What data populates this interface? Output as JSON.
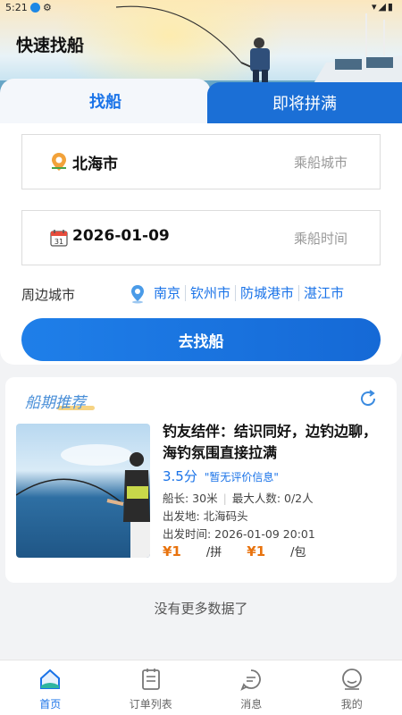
{
  "status": {
    "time": "5:21",
    "icons_right": "▾◢▮"
  },
  "header": {
    "title": "快速找船"
  },
  "tabs": [
    {
      "label": "找船",
      "active": true
    },
    {
      "label": "即将拼满",
      "active": false
    }
  ],
  "search": {
    "city": {
      "value": "北海市",
      "placeholder": "乘船城市",
      "icon": "map-pin-icon"
    },
    "date": {
      "value": "2026-01-09",
      "placeholder": "乘船时间",
      "icon": "calendar-icon"
    },
    "nearby": {
      "label": "周边城市",
      "cities": [
        "南京",
        "钦州市",
        "防城港市",
        "湛江市"
      ]
    },
    "button_label": "去找船"
  },
  "recommend": {
    "title": "船期推荐",
    "trip": {
      "name": "钓友结伴：结识同好，边钓边聊，海钓氛围直接拉满",
      "rating": "3.5分",
      "rating_note": "\"暂无评价信息\"",
      "length": "船长: 30米",
      "capacity": "最大人数: 0/2人",
      "departure": "出发地: 北海码头",
      "time": "出发时间: 2026-01-09 20:01",
      "price_share": "¥1",
      "price_share_unit": "/拼",
      "price_charter": "¥1",
      "price_charter_unit": "/包"
    }
  },
  "footer_note": "没有更多数据了",
  "nav": [
    {
      "label": "首页",
      "icon": "home-icon",
      "active": true
    },
    {
      "label": "订单列表",
      "icon": "order-list-icon",
      "active": false
    },
    {
      "label": "消息",
      "icon": "message-icon",
      "active": false
    },
    {
      "label": "我的",
      "icon": "profile-icon",
      "active": false
    }
  ],
  "colors": {
    "primary": "#1a73e8",
    "tab_active_bg": "#1b6fd6",
    "price": "#e8730e"
  }
}
